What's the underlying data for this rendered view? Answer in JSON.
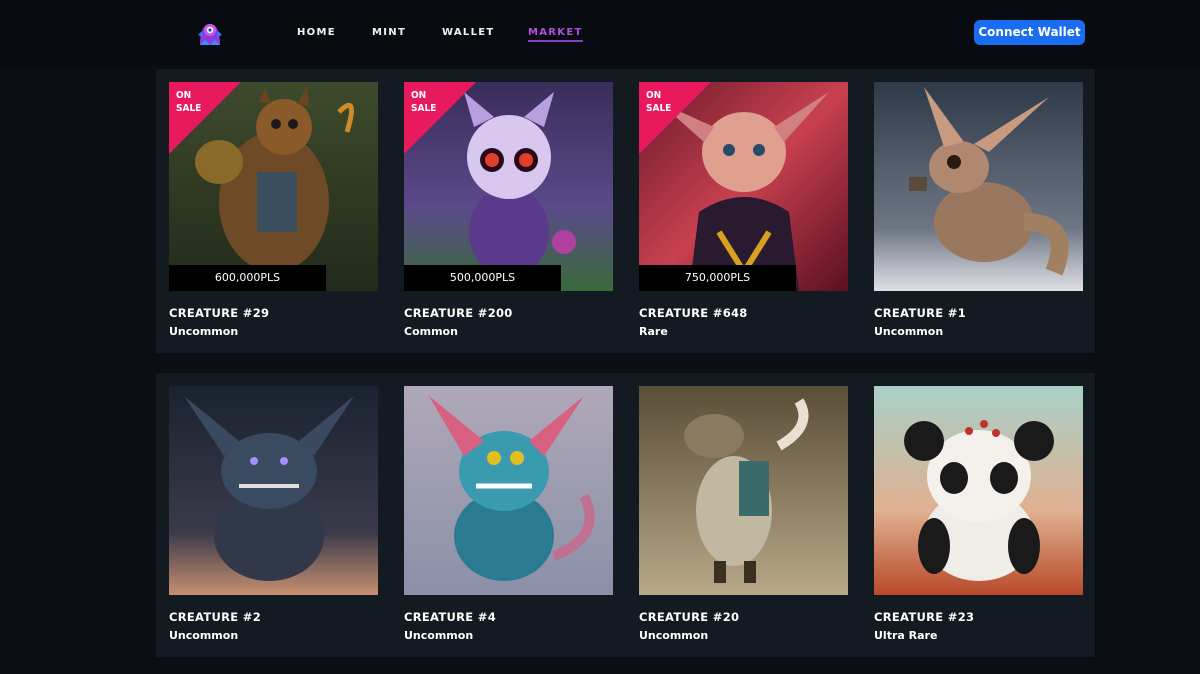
{
  "nav": {
    "links": [
      "HOME",
      "MINT",
      "WALLET",
      "MARKET"
    ],
    "active": "MARKET",
    "connect_label": "Connect Wallet"
  },
  "colors": {
    "background": "#0b0f14",
    "panel": "#141a21",
    "accent": "#b44ee0",
    "button": "#1a6cf0",
    "sale_ribbon": "#e8195c"
  },
  "sale_label_line1": "ON",
  "sale_label_line2": "SALE",
  "cards": [
    {
      "title": "CREATURE #29",
      "rarity": "Uncommon",
      "on_sale": true,
      "price": "600,000PLS"
    },
    {
      "title": "CREATURE #200",
      "rarity": "Common",
      "on_sale": true,
      "price": "500,000PLS"
    },
    {
      "title": "CREATURE #648",
      "rarity": "Rare",
      "on_sale": true,
      "price": "750,000PLS"
    },
    {
      "title": "CREATURE #1",
      "rarity": "Uncommon",
      "on_sale": false,
      "price": ""
    },
    {
      "title": "CREATURE #2",
      "rarity": "Uncommon",
      "on_sale": false,
      "price": ""
    },
    {
      "title": "CREATURE #4",
      "rarity": "Uncommon",
      "on_sale": false,
      "price": ""
    },
    {
      "title": "CREATURE #20",
      "rarity": "Uncommon",
      "on_sale": false,
      "price": ""
    },
    {
      "title": "CREATURE #23",
      "rarity": "Ultra Rare",
      "on_sale": false,
      "price": ""
    }
  ]
}
